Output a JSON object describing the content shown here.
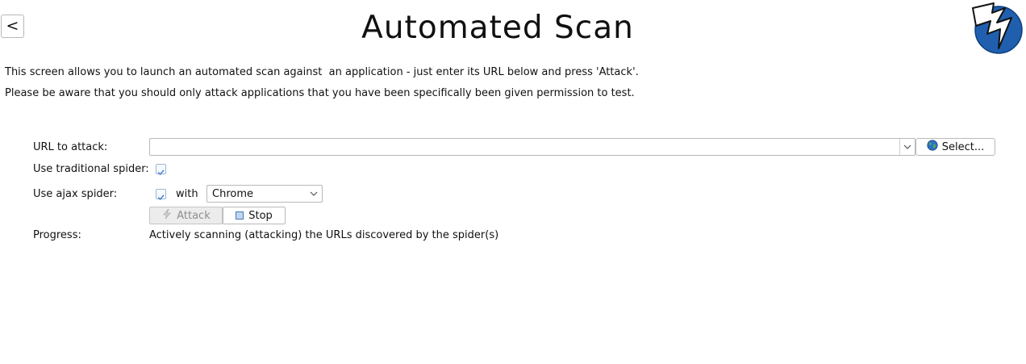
{
  "header": {
    "back_label": "<",
    "title": "Automated Scan"
  },
  "intro": {
    "line1": "This screen allows you to launch an automated scan against  an application - just enter its URL below and press 'Attack'.",
    "line2": "Please be aware that you should only attack applications that you have been specifically been given permission to test."
  },
  "form": {
    "url_label": "URL to attack:",
    "url_value": "",
    "select_label": "Select...",
    "traditional_spider_label": "Use traditional spider:",
    "traditional_spider_checked": true,
    "ajax_spider_label": "Use ajax spider:",
    "ajax_spider_checked": true,
    "with_label": "with",
    "browser_selected": "Chrome",
    "attack_label": "Attack",
    "stop_label": "Stop",
    "progress_label": "Progress:",
    "progress_status": "Actively scanning (attacking) the URLs discovered by the spider(s)"
  },
  "icons": {
    "back": "chevron-left-icon",
    "logo": "zap-logo-icon",
    "url_dropdown": "chevron-down-icon",
    "select": "globe-icon",
    "checkbox": "checkmark-icon",
    "browser_dropdown": "chevron-down-icon",
    "attack": "lightning-icon",
    "stop": "stop-icon"
  },
  "colors": {
    "accent": "#2a6fb8",
    "logo_blue": "#1f5fae",
    "checkmark": "#3d7ac7",
    "disabled_text": "#8d8d8d"
  }
}
